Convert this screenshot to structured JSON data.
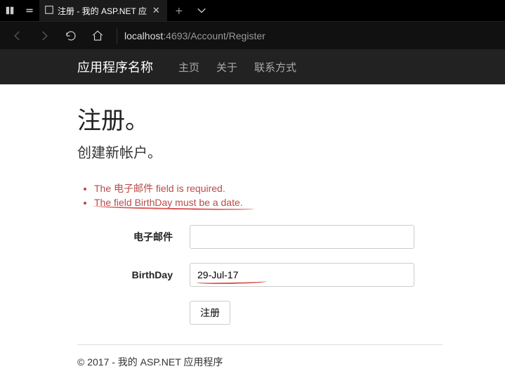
{
  "browser": {
    "tab_title": "注册 - 我的 ASP.NET 应",
    "url_host": "localhost",
    "url_path": ":4693/Account/Register"
  },
  "nav": {
    "brand": "应用程序名称",
    "links": [
      "主页",
      "关于",
      "联系方式"
    ]
  },
  "page": {
    "heading": "注册。",
    "subtitle": "创建新帐户。",
    "errors": [
      "The 电子邮件 field is required.",
      "The field BirthDay must be a date."
    ],
    "fields": {
      "email": {
        "label": "电子邮件",
        "value": ""
      },
      "birthday": {
        "label": "BirthDay",
        "value": "29-Jul-17"
      }
    },
    "submit_label": "注册"
  },
  "footer": {
    "text": "© 2017 - 我的 ASP.NET 应用程序"
  }
}
